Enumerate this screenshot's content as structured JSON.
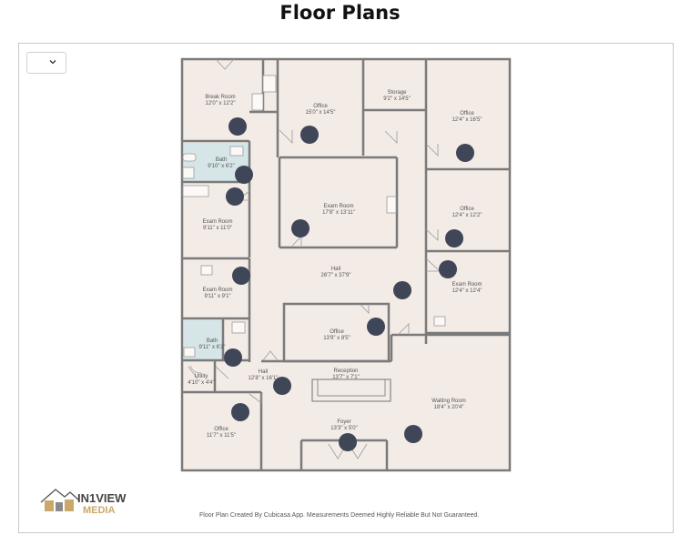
{
  "page": {
    "title": "Floor Plans"
  },
  "viewer": {
    "dropdown": {
      "value": ""
    },
    "footer": "Floor Plan Created By Cubicasa App. Measurements Deemed Highly Reliable But Not Guaranteed.",
    "logo": {
      "brand_top": "IN1VIEW",
      "brand_bottom": "MEDIA"
    }
  },
  "rooms": {
    "break_room": {
      "name": "Break Room",
      "dims": "12'0\" x 12'2\""
    },
    "office_1": {
      "name": "Office",
      "dims": "15'0\" x 14'5\""
    },
    "storage": {
      "name": "Storage",
      "dims": "9'2\" x 14'5\""
    },
    "office_2": {
      "name": "Office",
      "dims": "12'4\" x 16'5\""
    },
    "bath_1": {
      "name": "Bath",
      "dims": "9'10\" x 6'2\""
    },
    "exam_1": {
      "name": "Exam Room",
      "dims": "17'8\" x 13'11\""
    },
    "office_3": {
      "name": "Office",
      "dims": "12'4\" x 12'2\""
    },
    "exam_2": {
      "name": "Exam Room",
      "dims": "9'11\" x 11'0\""
    },
    "hall_1": {
      "name": "Hall",
      "dims": "26'7\" x 37'9\""
    },
    "exam_3": {
      "name": "Exam Room",
      "dims": "12'4\" x 12'4\""
    },
    "exam_4": {
      "name": "Exam Room",
      "dims": "9'11\" x 9'1\""
    },
    "office_4": {
      "name": "Office",
      "dims": "13'9\" x 8'5\""
    },
    "bath_2": {
      "name": "Bath",
      "dims": "9'11\" x 6'2\""
    },
    "hall_2": {
      "name": "Hall",
      "dims": "12'8\" x 16'1\""
    },
    "utility": {
      "name": "Utility",
      "dims": "4'10\" x 4'4\""
    },
    "reception": {
      "name": "Reception",
      "dims": "13'7\" x 7'1\""
    },
    "waiting": {
      "name": "Waiting Room",
      "dims": "18'4\" x 20'4\""
    },
    "office_5": {
      "name": "Office",
      "dims": "11'7\" x 11'5\""
    },
    "foyer": {
      "name": "Foyer",
      "dims": "13'3\" x 5'0\""
    }
  },
  "colors": {
    "floor": "#f3ebe6",
    "wall": "#7a7a7a",
    "bath": "#d6e6e8",
    "marker": "#3f4657"
  },
  "icons": {
    "dropdown": "chevron-down-icon",
    "marker": "camera-marker-icon",
    "logo": "house-logo-icon"
  }
}
